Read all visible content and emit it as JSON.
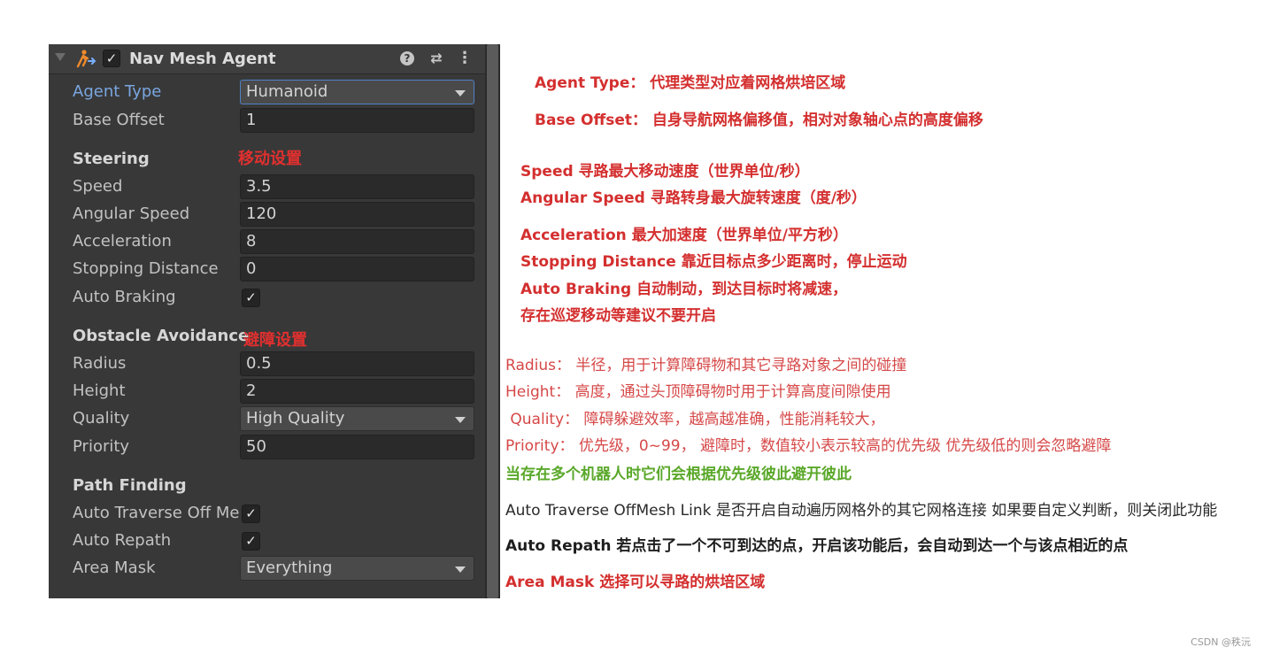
{
  "component": {
    "title": "Nav Mesh Agent",
    "enabled_mark": "✓",
    "help_glyph": "?",
    "preset_glyph": "⇄",
    "menu_glyph": "⋮"
  },
  "fields": {
    "agent_type": {
      "label": "Agent Type",
      "value": "Humanoid"
    },
    "base_offset": {
      "label": "Base Offset",
      "value": "1"
    }
  },
  "steering": {
    "header": "Steering",
    "note": "移动设置",
    "speed": {
      "label": "Speed",
      "value": "3.5"
    },
    "angular_speed": {
      "label": "Angular Speed",
      "value": "120"
    },
    "acceleration": {
      "label": "Acceleration",
      "value": "8"
    },
    "stopping_distance": {
      "label": "Stopping Distance",
      "value": "0"
    },
    "auto_braking": {
      "label": "Auto Braking",
      "checked": "✓"
    }
  },
  "obstacle": {
    "header": "Obstacle Avoidance",
    "note": "避障设置",
    "radius": {
      "label": "Radius",
      "value": "0.5"
    },
    "height": {
      "label": "Height",
      "value": "2"
    },
    "quality": {
      "label": "Quality",
      "value": "High Quality"
    },
    "priority": {
      "label": "Priority",
      "value": "50"
    }
  },
  "path": {
    "header": "Path Finding",
    "auto_traverse": {
      "label": "Auto Traverse Off Mesh Link",
      "checked": "✓"
    },
    "auto_repath": {
      "label": "Auto Repath",
      "checked": "✓"
    },
    "area_mask": {
      "label": "Area Mask",
      "value": "Everything"
    }
  },
  "notes": [
    "Agent Type： 代理类型对应着网格烘培区域",
    "Base Offset： 自身导航网格偏移值，相对对象轴心点的高度偏移",
    "Speed 寻路最大移动速度（世界单位/秒）",
    "Angular Speed 寻路转身最大旋转速度（度/秒）",
    "Acceleration 最大加速度（世界单位/平方秒）",
    "Stopping Distance 靠近目标点多少距离时，停止运动",
    "Auto Braking 自动制动，到达目标时将减速，",
    "存在巡逻移动等建议不要开启",
    "Radius： 半径，用于计算障碍物和其它寻路对象之间的碰撞",
    "Height： 高度，通过头顶障碍物时用于计算高度间隙使用",
    " Quality： 障碍躲避效率，越高越准确，性能消耗较大，",
    "Priority： 优先级，0~99， 避障时，数值较小表示较高的优先级 优先级低的则会忽略避障",
    "当存在多个机器人时它们会根据优先级彼此避开彼此",
    "Auto Traverse OffMesh Link 是否开启自动遍历网格外的其它网格连接 如果要自定义判断，则关闭此功能",
    "Auto Repath 若点击了一个不可到达的点，开启该功能后，会自动到达一个与该点相近的点",
    "Area Mask 选择可以寻路的烘培区域"
  ],
  "watermark": "CSDN @秩沅",
  "colors": {
    "panel_bg": "#383838",
    "field_bg": "#2a2a2a",
    "active_label": "#7aa6e0",
    "note_red": "#d42f2f",
    "note_green": "#5aa82a"
  }
}
